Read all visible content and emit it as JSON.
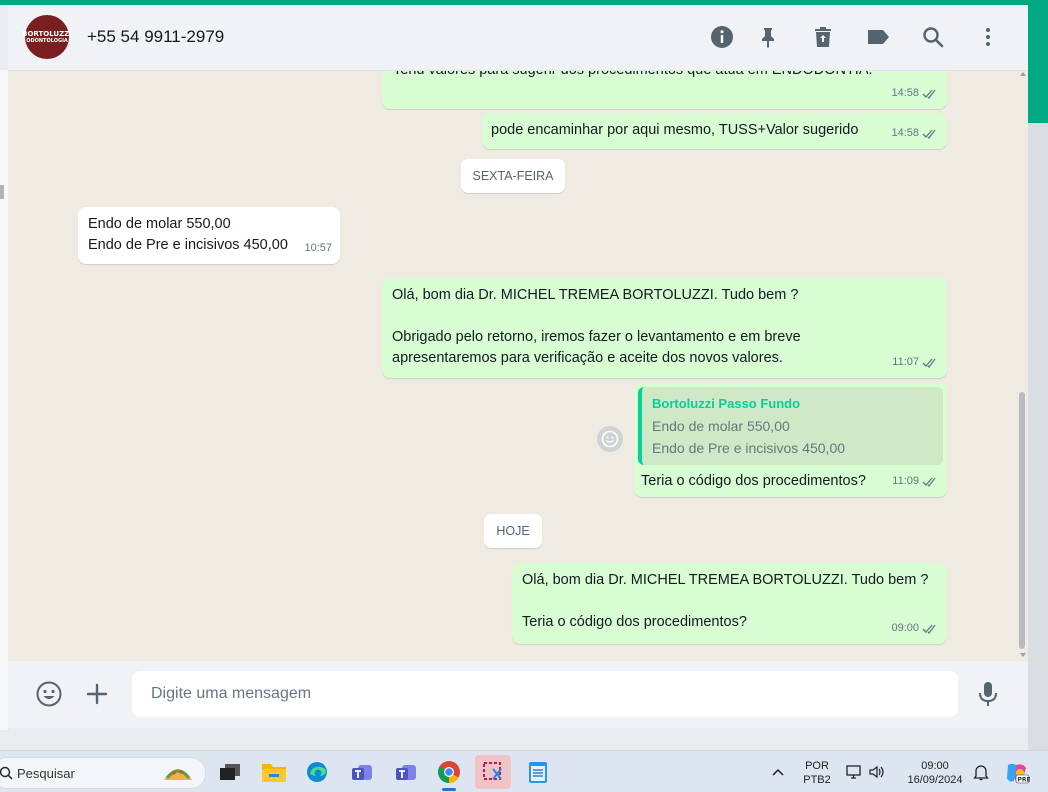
{
  "chat": {
    "contact_name": "+55 54 9911-2979",
    "avatar_text_1": "BORTOLUZZI",
    "avatar_text_2": "ODONTOLOGIA"
  },
  "messages": {
    "m0_text": "Tenu valores para sugerir dos procedimentos que atua em ENDODONTIA.",
    "m0_time": "14:58",
    "m1_text": "pode encaminhar por aqui mesmo, TUSS+Valor sugerido",
    "m1_time": "14:58",
    "day1": "SEXTA-FEIRA",
    "m2_text": "Endo de molar 550,00\nEndo de Pre e incisivos 450,00",
    "m2_time": "10:57",
    "m3_text": "Olá, bom dia Dr. MICHEL TREMEA BORTOLUZZI. Tudo bem ?\n\nObrigado pelo retorno, iremos fazer o levantamento e em breve\napresentaremos para verificação e aceite dos novos valores.",
    "m3_time": "11:07",
    "m4_quote_author": "Bortoluzzi Passo Fundo",
    "m4_quote_text": "Endo de molar 550,00\nEndo de Pre e incisivos 450,00",
    "m4_text": "Teria o código dos procedimentos?",
    "m4_time": "11:09",
    "day2": "HOJE",
    "m5_text": "Olá, bom dia Dr. MICHEL TREMEA BORTOLUZZI. Tudo bem ?\n\nTeria o código dos procedimentos?",
    "m5_time": "09:00"
  },
  "composer": {
    "placeholder": "Digite uma mensagem"
  },
  "taskbar": {
    "search_label": "Pesquisar",
    "lang_1": "POR",
    "lang_2": "PTB2",
    "time": "09:00",
    "date": "16/09/2024",
    "icons": [
      "taco-widget-icon",
      "terminal-icon",
      "file-explorer-icon",
      "edge-icon",
      "teams-icon",
      "teams-icon",
      "chrome-icon",
      "snipping-tool-icon",
      "notepad-icon"
    ]
  },
  "colors": {
    "accent": "#00a884",
    "outgoing_bubble": "#d9fdd3",
    "incoming_bubble": "#ffffff",
    "chat_background": "#efeae2",
    "header_background": "#f0f2f5",
    "quote_author": "#06cf9c"
  }
}
